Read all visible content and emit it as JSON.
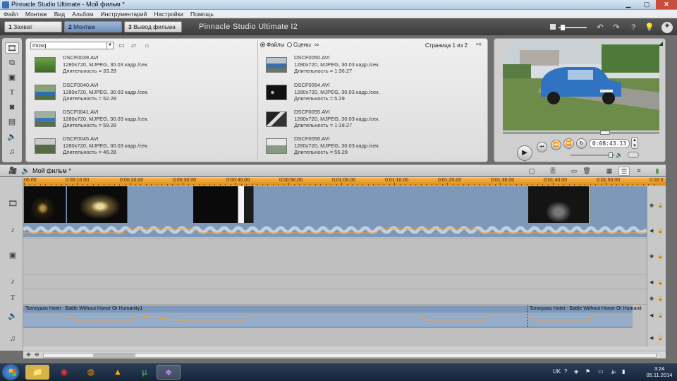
{
  "window": {
    "title": "Pinnacle Studio Ultimate - Мой фильм *"
  },
  "menu": [
    "Файл",
    "Монтаж",
    "Вид",
    "Альбом",
    "Инструментарий",
    "Настройки",
    "Помощь"
  ],
  "modes": [
    {
      "num": "1",
      "label": "Захват",
      "active": false
    },
    {
      "num": "2",
      "label": "Монтаж",
      "active": true
    },
    {
      "num": "3",
      "label": "Вывод фильма",
      "active": false
    }
  ],
  "brand": "Pinnacle Studio Ultimate I2",
  "album": {
    "folder": "mosq",
    "view_files": "Файлы",
    "view_scenes": "Сцены",
    "page": "Страница 1 из 2",
    "left_clips": [
      {
        "name": "DSCF0039.AVI",
        "info": "1280x720, MJPEG, 30.03 кадр./сек.",
        "duration": "Длительность = 33.28",
        "thumb": "#4f8a35"
      },
      {
        "name": "DSCF0040.AVI",
        "info": "1280x720, MJPEG, 30.03 кадр./сек.",
        "duration": "Длительность = 52.28",
        "thumb": "#5d7f52"
      },
      {
        "name": "DSCF0041.AVI",
        "info": "1280x720, MJPEG, 30.03 кадр./сек.",
        "duration": "Длительность = 59.28",
        "thumb": "#627a58"
      },
      {
        "name": "DSCF0045.AVI",
        "info": "1280x720, MJPEG, 30.03 кадр./сек.",
        "duration": "Длительность = 46.28",
        "thumb": "#6a6f5e"
      }
    ],
    "right_clips": [
      {
        "name": "DSCF0050.AVI",
        "info": "1280x720, MJPEG, 30.03 кадр./сек.",
        "duration": "Длительность = 1:36.27",
        "thumb": "#5a7391"
      },
      {
        "name": "DSCF0054.AVI",
        "info": "1280x720, MJPEG, 30.03 кадр./сек.",
        "duration": "Длительность = 5.29",
        "thumb": "#111111"
      },
      {
        "name": "DSCF0055.AVI",
        "info": "1280x720, MJPEG, 30.03 кадр./сек.",
        "duration": "Длительность = 1:18.27",
        "thumb": "#2a2a2a"
      },
      {
        "name": "DSCF0056.AVI",
        "info": "1280x720, MJPEG, 30.03 кадр./сек.",
        "duration": "Длительность = 56.28",
        "thumb": "#7e8c88"
      }
    ]
  },
  "preview": {
    "timecode": "0:08:43.13"
  },
  "timeline": {
    "movie_title": "Мой фильм *",
    "ruler_labels": [
      "00.00",
      "0:00:10.00",
      "0:00:20.00",
      "0:00:30.00",
      "0:00:40.00",
      "0:00:50.00",
      "0:01:00.00",
      "0:01:10.00",
      "0:01:20.00",
      "0:01:30.00",
      "0:01:40.00",
      "0:01:50.00",
      "0:02:0"
    ],
    "music_label_1": "Tomoyasu Hotei - Battle Without Honor Or Humanity1",
    "music_label_2": "Tomoyasu Hotei - Battle Without Honor Or Humanit"
  },
  "taskbar": {
    "lang": "UK",
    "time": "3:24",
    "date": "05.11.2014"
  },
  "colors": {
    "ruler": "#e89a22",
    "track": "#7d98b8",
    "waveform": "#c9d6e6",
    "envelope": "#f0a030"
  }
}
